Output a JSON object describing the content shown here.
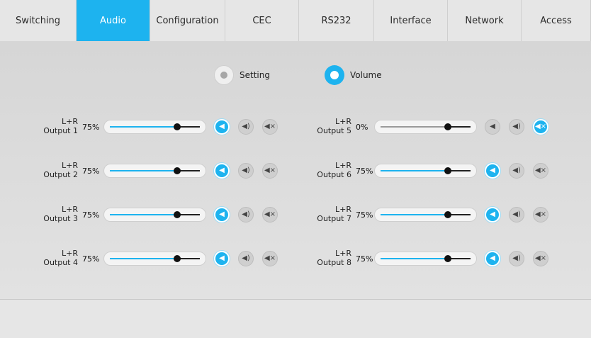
{
  "tabs": [
    {
      "label": "Switching",
      "active": false
    },
    {
      "label": "Audio",
      "active": true
    },
    {
      "label": "Configuration",
      "active": false
    },
    {
      "label": "CEC",
      "active": false
    },
    {
      "label": "RS232",
      "active": false
    },
    {
      "label": "Interface",
      "active": false
    },
    {
      "label": "Network",
      "active": false
    },
    {
      "label": "Access",
      "active": false
    }
  ],
  "mode": {
    "setting_label": "Setting",
    "volume_label": "Volume",
    "selected": "Volume"
  },
  "outputs": [
    {
      "channel": "L+R",
      "name": "Output 1",
      "volume": "75%",
      "level": 0.75,
      "active_button": "unmute"
    },
    {
      "channel": "L+R",
      "name": "Output 2",
      "volume": "75%",
      "level": 0.75,
      "active_button": "unmute"
    },
    {
      "channel": "L+R",
      "name": "Output 3",
      "volume": "75%",
      "level": 0.75,
      "active_button": "unmute"
    },
    {
      "channel": "L+R",
      "name": "Output 4",
      "volume": "75%",
      "level": 0.75,
      "active_button": "unmute"
    },
    {
      "channel": "L+R",
      "name": "Output 5",
      "volume": "0%",
      "level": 0.75,
      "active_button": "mute"
    },
    {
      "channel": "L+R",
      "name": "Output 6",
      "volume": "75%",
      "level": 0.75,
      "active_button": "unmute"
    },
    {
      "channel": "L+R",
      "name": "Output 7",
      "volume": "75%",
      "level": 0.75,
      "active_button": "unmute"
    },
    {
      "channel": "L+R",
      "name": "Output 8",
      "volume": "75%",
      "level": 0.75,
      "active_button": "unmute"
    }
  ],
  "button_icons": [
    "speaker-low-icon",
    "speaker-high-icon",
    "speaker-mute-icon"
  ],
  "colors": {
    "accent": "#1db3ef",
    "inactive": "#cfcfcf"
  }
}
